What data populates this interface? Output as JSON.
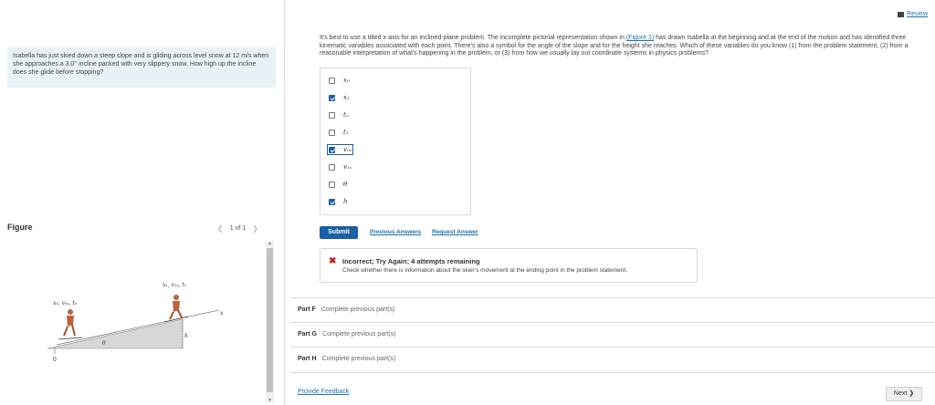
{
  "problem": {
    "text": "Isabella has just skied down a steep slope and is gliding across level snow at 12 m/s when she approaches a 3.0° incline packed with very slippery snow. How high up the incline does she glide before stopping?"
  },
  "figure": {
    "title": "Figure",
    "pager": "1 of 1",
    "labels": {
      "start_vars": "x₀, v₀ₓ, t₀",
      "end_vars": "x₁, v₁ₓ, t₁",
      "axis_x": "x",
      "height": "h",
      "angle": "θ",
      "origin": "0"
    }
  },
  "header": {
    "review_label": "Review"
  },
  "question": {
    "intro_before_link": "It's best to use a tilted x-axis for an inclined-plane problem. The incomplete pictorial representation shown in ",
    "figure_link": "(Figure 1)",
    "intro_after_link": " has drawn Isabella at the beginning and at the end of the motion and has identified three kinematic variables associated with each point. There's also a symbol for the angle of the slope and for the height she reaches. Which of these variables do you know (1) from the problem statement, (2) from a reasonable interpretation of what's happening in the problem, or (3) from how we usually lay out coordinate systems in physics problems?"
  },
  "options": [
    {
      "label": "x₀",
      "checked": false
    },
    {
      "label": "x₁",
      "checked": true
    },
    {
      "label": "t₀",
      "checked": false
    },
    {
      "label": "t₁",
      "checked": false
    },
    {
      "label": "v₀ₓ",
      "checked": true
    },
    {
      "label": "v₁ₓ",
      "checked": false
    },
    {
      "label": "θ",
      "checked": false
    },
    {
      "label": "h",
      "checked": true
    }
  ],
  "actions": {
    "submit": "Submit",
    "previous_answers": "Previous Answers",
    "request_answer": "Request Answer"
  },
  "feedback": {
    "heading": "Incorrect; Try Again; 4 attempts remaining",
    "text": "Check whether there is information about the skier's movement at the ending point in the problem statement."
  },
  "parts": [
    {
      "name": "Part F",
      "status": "Complete previous part(s)"
    },
    {
      "name": "Part G",
      "status": "Complete previous part(s)"
    },
    {
      "name": "Part H",
      "status": "Complete previous part(s)"
    }
  ],
  "footer": {
    "provide_feedback": "Provide Feedback",
    "next": "Next ❯"
  },
  "colors": {
    "accent": "#1a5fa8",
    "link": "#1a73b5",
    "error": "#c8201d",
    "problem_bg": "#e8f2f6"
  }
}
